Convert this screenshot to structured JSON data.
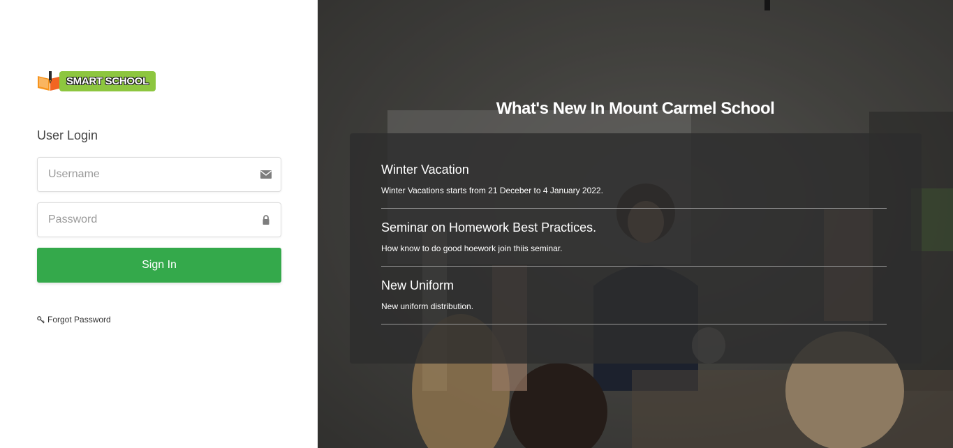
{
  "brand": {
    "name": "SMART SCHOOL",
    "badge_color": "#8dc63f"
  },
  "login": {
    "title": "User Login",
    "username_placeholder": "Username",
    "password_placeholder": "Password",
    "signin_label": "Sign In",
    "forgot_label": "Forgot Password",
    "accent": "#34a94b"
  },
  "news": {
    "heading": "What's New In Mount Carmel School",
    "items": [
      {
        "title": "Winter Vacation",
        "text": "Winter Vacations starts from 21 Deceber to 4 January 2022."
      },
      {
        "title": "Seminar on Homework Best Practices.",
        "text": "How know to do good hoework join thiis seminar."
      },
      {
        "title": "New Uniform",
        "text": "New uniform distribution."
      }
    ]
  },
  "icons": {
    "username": "envelope-icon",
    "password": "lock-icon",
    "forgot": "key-icon",
    "logo": "open-book-pen-icon"
  }
}
